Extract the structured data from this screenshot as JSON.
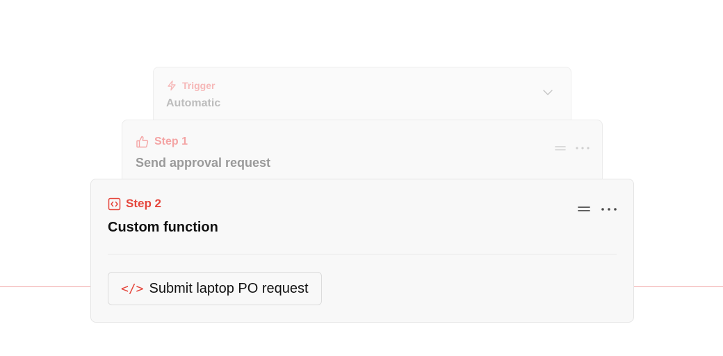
{
  "trigger": {
    "label": "Trigger",
    "title": "Automatic",
    "icon": "lightning-icon",
    "color": "#f6b8b8"
  },
  "step1": {
    "label": "Step 1",
    "title": "Send approval request",
    "icon": "thumbs-up-icon",
    "color": "#f4a4a4"
  },
  "step2": {
    "label": "Step 2",
    "title": "Custom function",
    "icon": "code-icon",
    "color": "#e5463c",
    "function_button": {
      "glyph": "</>",
      "label": "Submit laptop PO request"
    }
  },
  "colors": {
    "accent": "#e5463c",
    "guide_line": "#f0a6a6"
  }
}
